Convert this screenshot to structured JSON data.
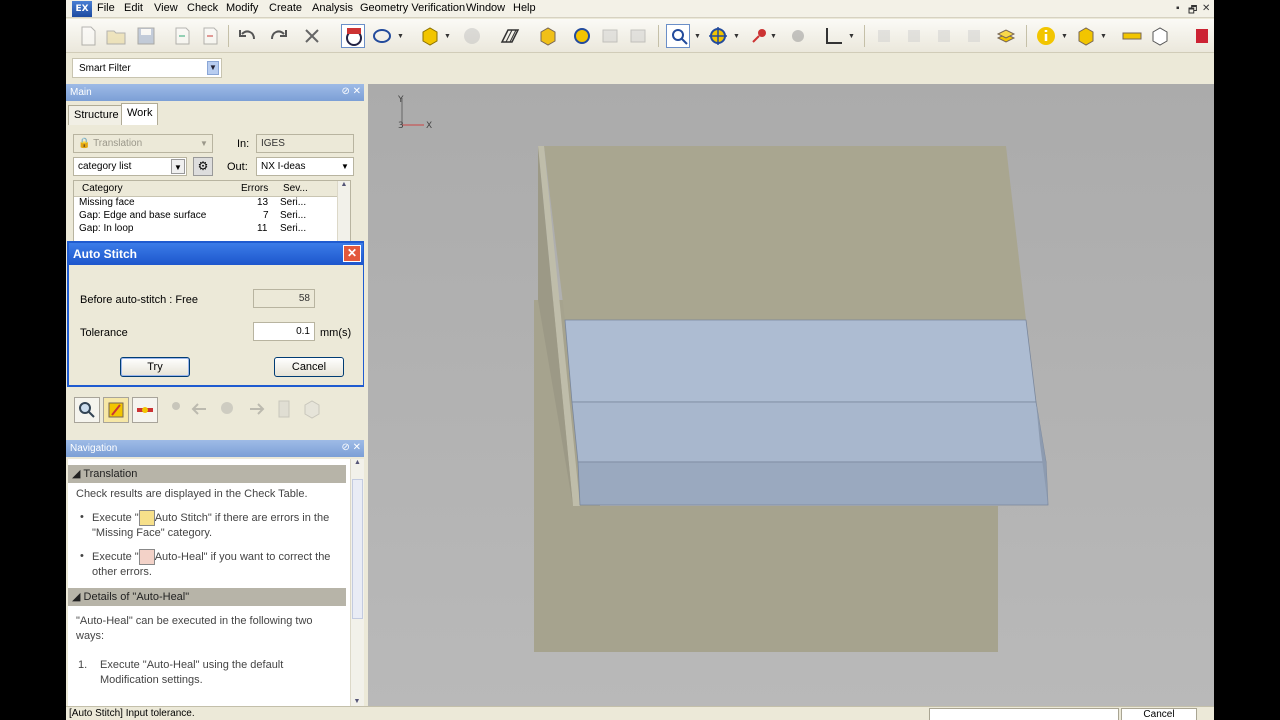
{
  "menubar": {
    "logo": "EX",
    "items": [
      "File",
      "Edit",
      "View",
      "Check",
      "Modify",
      "Create",
      "Analysis",
      "Geometry Verification",
      "Window",
      "Help"
    ],
    "window_buttons": [
      "▪",
      "🗗",
      "✕"
    ]
  },
  "filter": {
    "label": "Smart Filter"
  },
  "main_panel": {
    "title": "Main",
    "tabs": [
      "Structure",
      "Work"
    ],
    "active_tab": "Work",
    "translation_select": "Translation",
    "in_label": "In:",
    "in_value": "IGES",
    "category_select": "category list",
    "out_label": "Out:",
    "out_value": "NX I-deas",
    "list": {
      "headers": [
        "Category",
        "Errors",
        "Sev..."
      ],
      "rows": [
        [
          "Missing face",
          "13",
          "Seri..."
        ],
        [
          "Gap: Edge and base surface",
          "7",
          "Seri..."
        ],
        [
          "Gap: In loop",
          "11",
          "Seri..."
        ]
      ]
    }
  },
  "dialog": {
    "title": "Auto Stitch",
    "before_label": "Before auto-stitch : Free",
    "before_value": "58",
    "tolerance_label": "Tolerance",
    "tolerance_value": "0.1",
    "unit": "mm(s)",
    "try_label": "Try",
    "cancel_label": "Cancel"
  },
  "navigation": {
    "title": "Navigation",
    "section1": "Translation",
    "intro": "Check results are displayed in the Check Table.",
    "bullet1_pre": "Execute \"",
    "bullet1_post": "Auto Stitch\" if there are errors in the \"Missing Face\" category.",
    "bullet2_pre": "Execute \"",
    "bullet2_post": "Auto-Heal\" if you want to correct the other errors.",
    "section2": "Details of \"Auto-Heal\"",
    "para2": "\"Auto-Heal\" can be executed in the following two ways:",
    "item1_num": "1.",
    "item1": "Execute \"Auto-Heal\" using the default Modification settings."
  },
  "status": {
    "text": "[Auto Stitch] Input tolerance.",
    "cancel": "Cancel"
  },
  "axes": {
    "y": "Y",
    "z": "3",
    "x": "X"
  },
  "colors": {
    "title_bar": "#1d56cc",
    "panel_title": "#7c9fd6",
    "viewport_bg": "#b1b1b1",
    "face_gray": "#a7a48e",
    "face_blue": "#a9b8cf"
  }
}
